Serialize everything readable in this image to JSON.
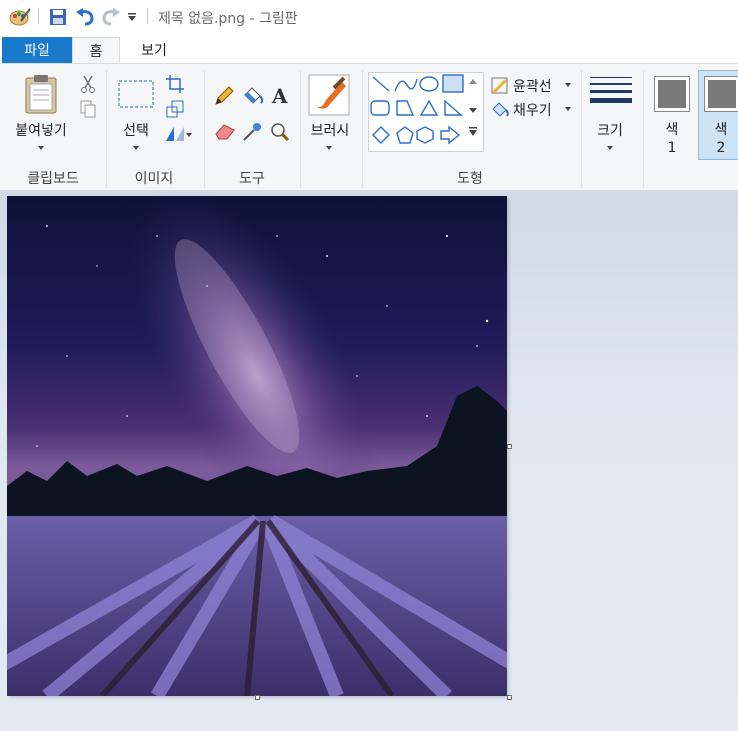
{
  "titlebar": {
    "document_title": "제목 없음.png - 그림판",
    "icons": [
      "paint-app-icon",
      "save-icon",
      "undo-icon",
      "redo-icon",
      "customize-quick-access-icon"
    ]
  },
  "tabs": {
    "file": "파일",
    "home": "홈",
    "view": "보기"
  },
  "ribbon": {
    "clipboard": {
      "paste_label": "붙여넣기",
      "group_label": "클립보드"
    },
    "image": {
      "select_label": "선택",
      "group_label": "이미지"
    },
    "tools": {
      "group_label": "도구"
    },
    "brushes": {
      "label": "브러시"
    },
    "shapes": {
      "outline_label": "윤곽선",
      "fill_label": "채우기",
      "group_label": "도형"
    },
    "size": {
      "label": "크기"
    },
    "color1": {
      "label_top": "색",
      "label_bottom": "1"
    },
    "color2": {
      "label_top": "색",
      "label_bottom": "2"
    }
  },
  "colors": {
    "accent": "#1979ca",
    "ribbon_bg": "#f5f6f7",
    "workspace_bg": "#dfe7ef",
    "color1": "#7a7a7a",
    "color2": "#7a7a7a"
  }
}
